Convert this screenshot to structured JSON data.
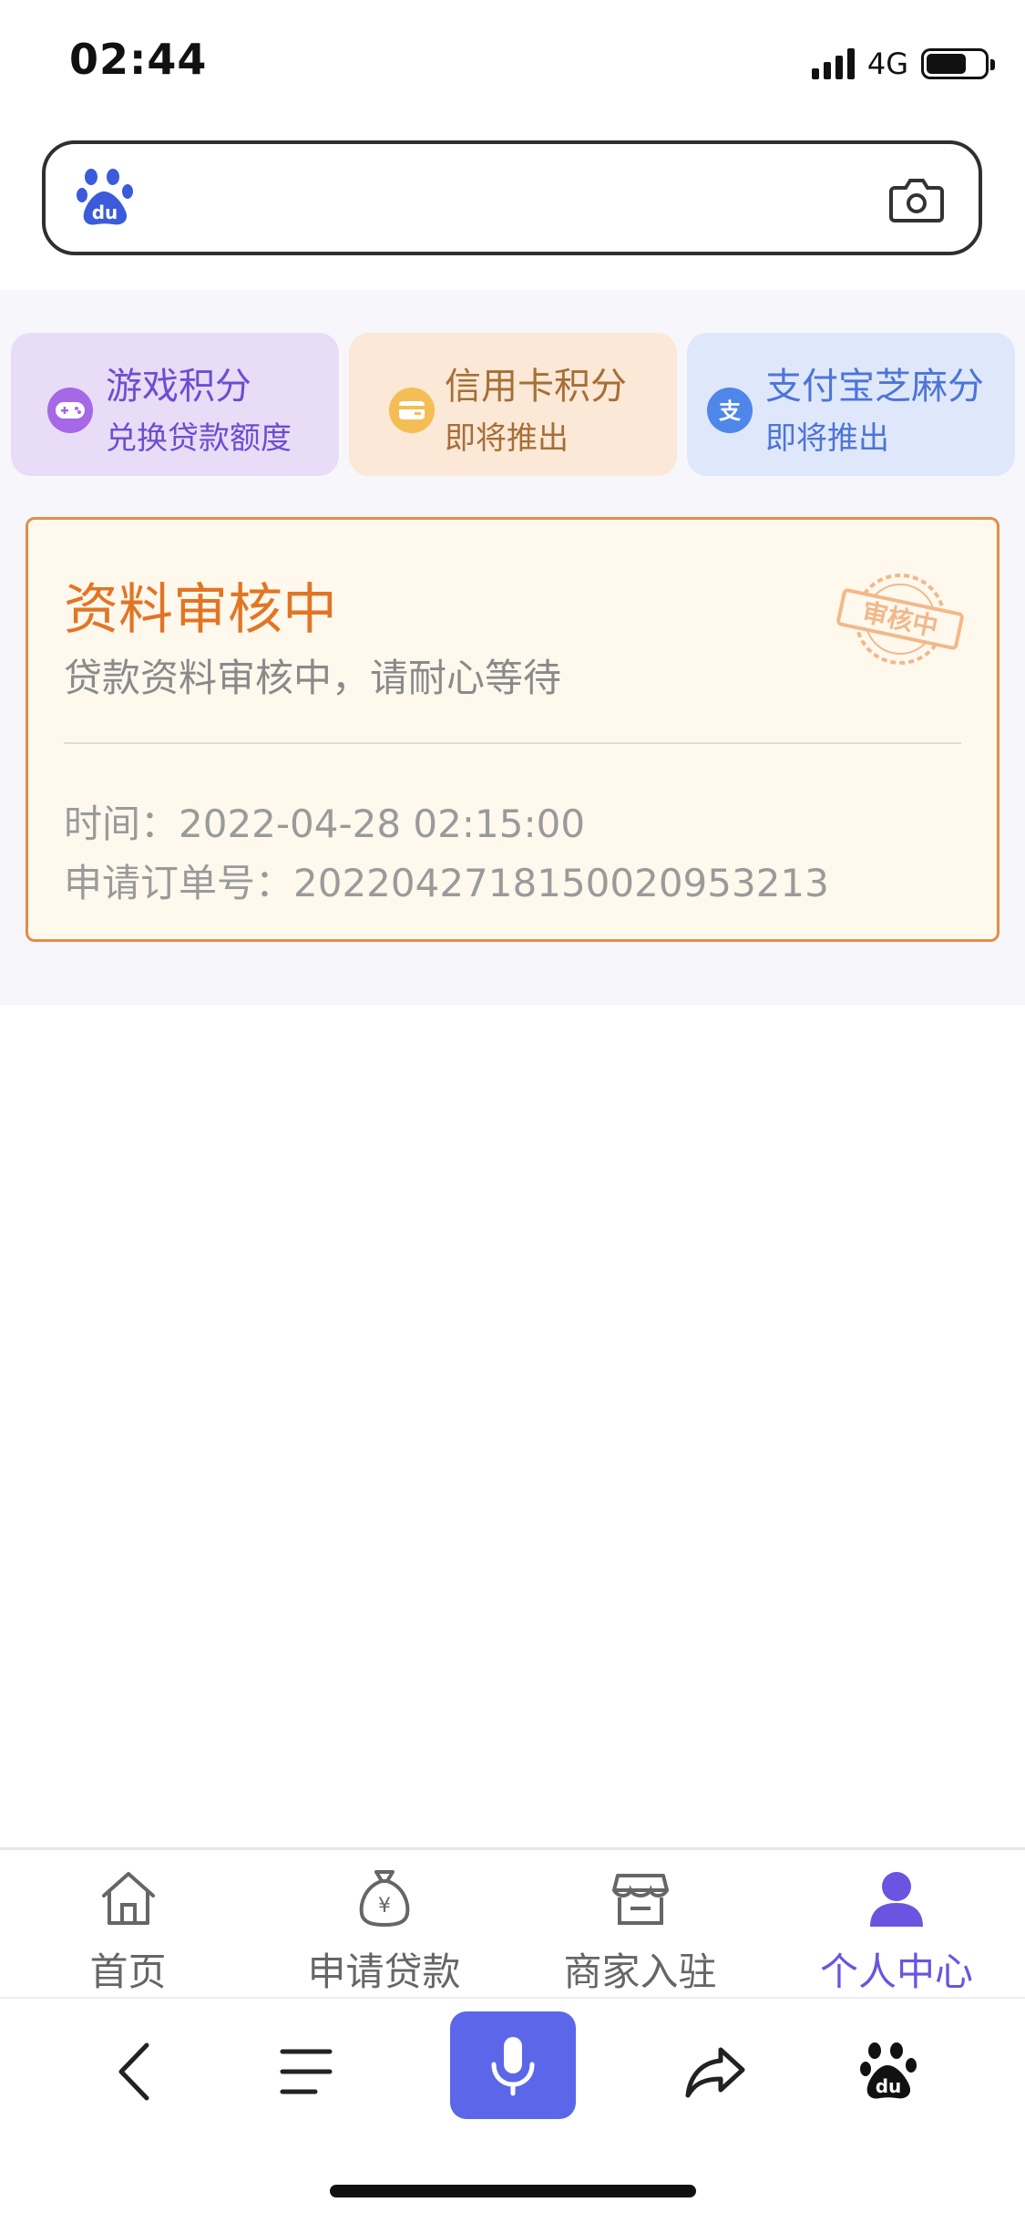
{
  "status_bar": {
    "time": "02:44",
    "network": "4G"
  },
  "features": [
    {
      "title": "游戏积分",
      "subtitle": "兑换贷款额度",
      "icon": "gamepad-icon"
    },
    {
      "title": "信用卡积分",
      "subtitle": "即将推出",
      "icon": "wallet-card-icon"
    },
    {
      "title": "支付宝芝麻分",
      "subtitle": "即将推出",
      "icon": "alipay-icon"
    }
  ],
  "review": {
    "title": "资料审核中",
    "description": "贷款资料审核中，请耐心等待",
    "time": "时间：2022-04-28 02:15:00",
    "order": "申请订单号：20220427181500209532​13",
    "stamp_text": "审核中"
  },
  "tabs": [
    {
      "label": "首页",
      "icon": "home-icon",
      "active": false
    },
    {
      "label": "申请贷款",
      "icon": "money-bag-icon",
      "active": false
    },
    {
      "label": "商家入驻",
      "icon": "store-icon",
      "active": false
    },
    {
      "label": "个人中心",
      "icon": "user-icon",
      "active": true
    }
  ],
  "colors": {
    "accent": "#6a54e0",
    "review_orange": "#e27524",
    "mic_blue": "#5b67e8"
  }
}
